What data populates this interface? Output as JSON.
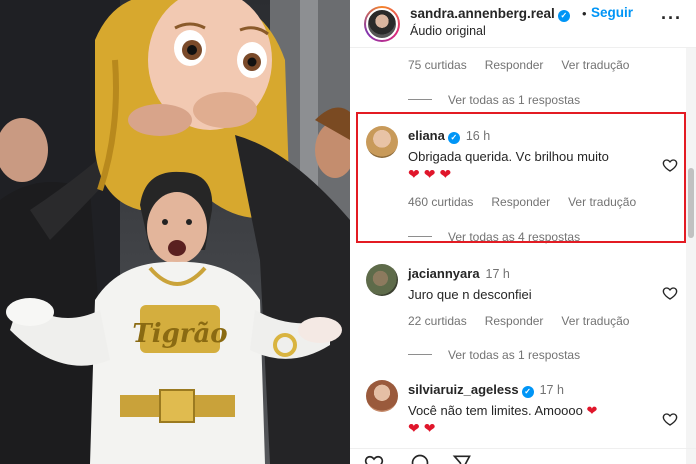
{
  "header": {
    "username": "sandra.annenberg.real",
    "verified": true,
    "dot": "•",
    "follow_label": "Seguir",
    "audio_label": "Áudio original",
    "more_icon": "more-horizontal-icon"
  },
  "top_thread": {
    "likes": "75 curtidas",
    "reply": "Responder",
    "translate": "Ver tradução",
    "view_all": "Ver todas as 1 respostas"
  },
  "comments": [
    {
      "username": "eliana",
      "verified": true,
      "time": "16 h",
      "text": "Obrigada querida. Vc brilhou muito",
      "hearts": "❤❤❤",
      "likes": "460 curtidas",
      "reply": "Responder",
      "translate": "Ver tradução",
      "view_all": "Ver todas as 4 respostas"
    },
    {
      "username": "jaciannyara",
      "verified": false,
      "time": "17 h",
      "text": "Juro que n desconfiei",
      "likes": "22 curtidas",
      "reply": "Responder",
      "translate": "Ver tradução",
      "view_all": "Ver todas as 1 respostas"
    },
    {
      "username": "silviaruiz_ageless",
      "verified": true,
      "time": "17 h",
      "text": "Você não tem limites. Amoooo",
      "hearts_inline": "❤",
      "hearts": "❤❤"
    }
  ],
  "photo": {
    "chain_text": "Tigrão"
  },
  "colors": {
    "accent": "#0095f6",
    "highlight": "#e31b23",
    "heart": "#e0162b"
  }
}
